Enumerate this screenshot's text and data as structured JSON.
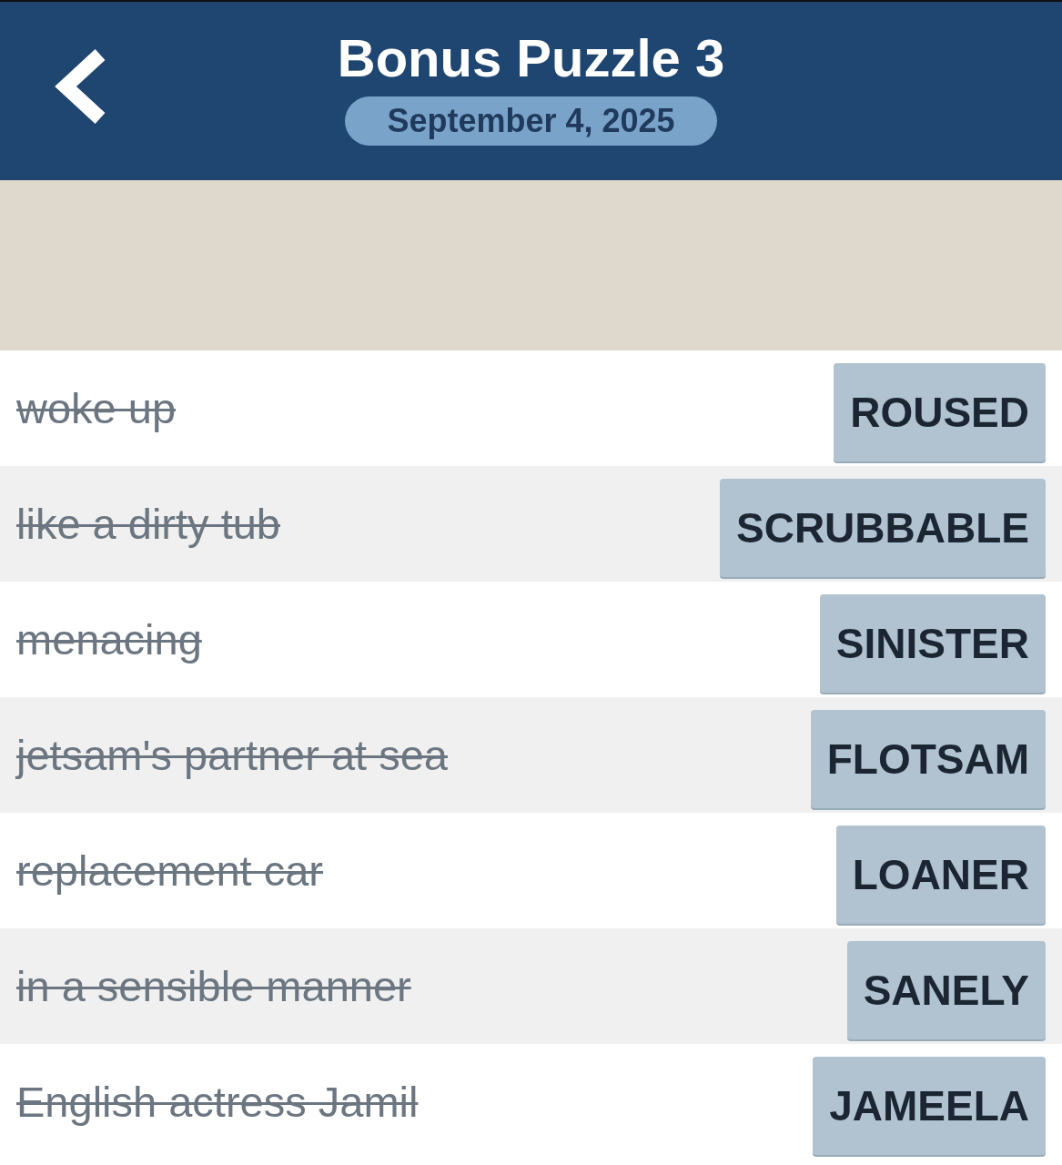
{
  "header": {
    "title": "Bonus Puzzle 3",
    "date": "September 4, 2025"
  },
  "clues": [
    {
      "clue": "woke up",
      "answer": "ROUSED",
      "solved": true
    },
    {
      "clue": "like a dirty tub",
      "answer": "SCRUBBABLE",
      "solved": true
    },
    {
      "clue": "menacing",
      "answer": "SINISTER",
      "solved": true
    },
    {
      "clue": "jetsam's partner at sea",
      "answer": "FLOTSAM",
      "solved": true
    },
    {
      "clue": "replacement car",
      "answer": "LOANER",
      "solved": true
    },
    {
      "clue": "in a sensible manner",
      "answer": "SANELY",
      "solved": true
    },
    {
      "clue": "English actress Jamil",
      "answer": "JAMEELA",
      "solved": true
    }
  ]
}
